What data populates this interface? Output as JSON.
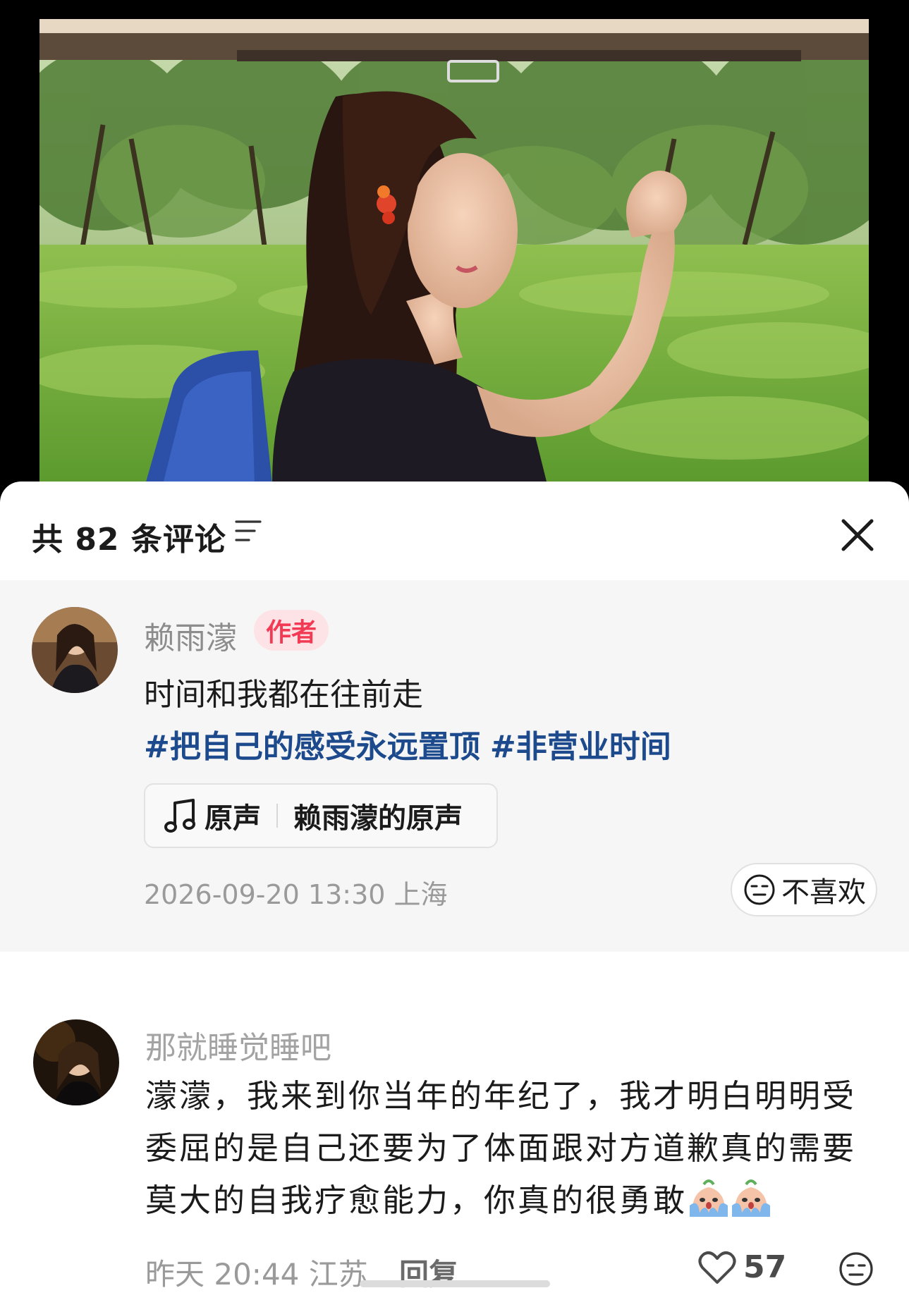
{
  "comments_panel": {
    "title": "共 82 条评论",
    "sort_icon": "sort-lines-icon",
    "close_icon": "close-icon"
  },
  "author_comment": {
    "username": "赖雨濛",
    "badge": "作者",
    "text": "时间和我都在往前走",
    "hashtags": [
      "#把自己的感受永远置顶",
      "#非营业时间"
    ],
    "sound": {
      "icon": "music-note-icon",
      "label": "原声",
      "source": "赖雨濛的原声"
    },
    "meta": "2026-09-20 13:30 上海",
    "dislike_label": "不喜欢",
    "badge_color": "#f23a55",
    "hashtag_color": "#1d4a8c"
  },
  "comments": [
    {
      "username": "那就睡觉睡吧",
      "text": "濛濛，我来到你当年的年纪了，我才明白明明受委屈的是自己还要为了体面跟对方道歉真的需要莫大的自我疗愈能力，你真的很勇敢",
      "emoji": [
        "crying-emoji",
        "crying-emoji"
      ],
      "meta": "昨天 20:44 江苏",
      "reply_label": "回复",
      "likes": "57",
      "like_icon": "heart-icon",
      "dislike_icon": "neutral-face-icon"
    }
  ]
}
